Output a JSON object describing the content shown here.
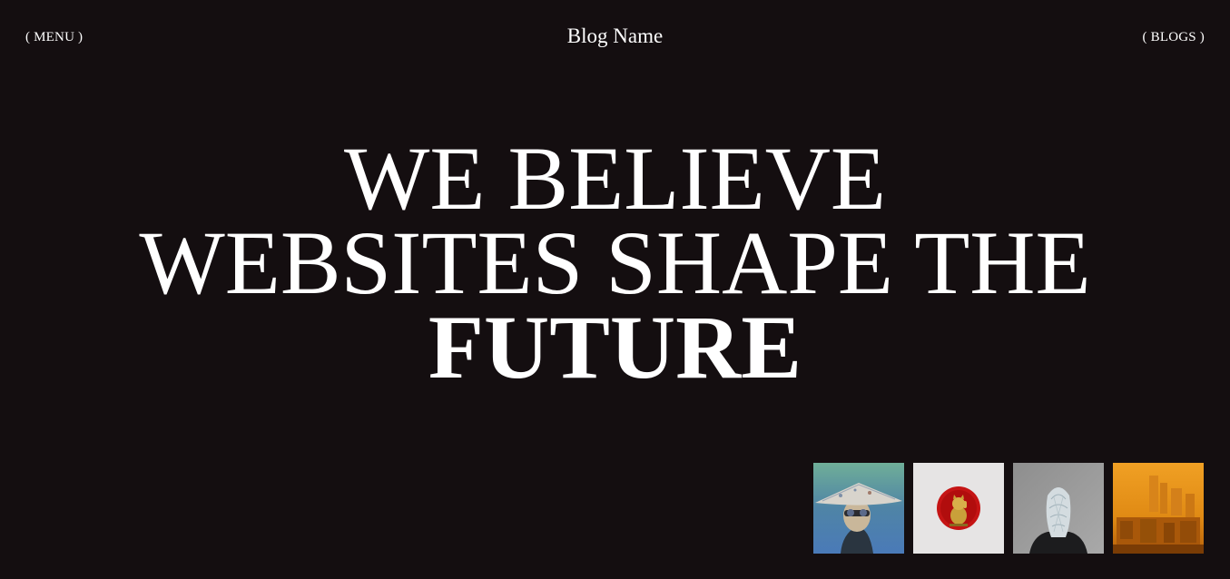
{
  "nav": {
    "menu_label": "( MENU )",
    "blogs_label": "( BLOGS )"
  },
  "brand": {
    "name": "Blog Name"
  },
  "hero": {
    "line1": "WE BELIEVE",
    "line2": "WEBSITES SHAPE THE",
    "line3": "FUTURE"
  },
  "thumbnails": [
    {
      "name": "thumb-person-hat",
      "icon": "portrait-with-hat"
    },
    {
      "name": "thumb-lucky-cat",
      "icon": "gold-lucky-cat-on-red-disc"
    },
    {
      "name": "thumb-veiled-figure",
      "icon": "veiled-figure-portrait"
    },
    {
      "name": "thumb-orange-city",
      "icon": "orange-city-skyline"
    }
  ],
  "colors": {
    "background": "#140e10",
    "text": "#ffffff"
  }
}
